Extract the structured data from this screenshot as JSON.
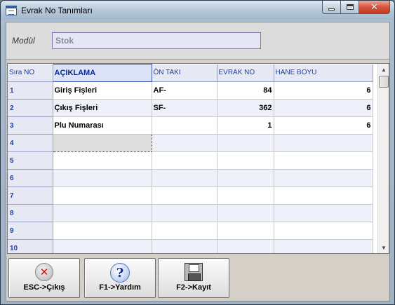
{
  "window": {
    "title": "Evrak No Tanımları"
  },
  "module": {
    "label": "Modül",
    "value": "Stok"
  },
  "grid": {
    "columns": [
      "Sıra NO",
      "AÇIKLAMA",
      "ÖN TAKI",
      "EVRAK NO",
      "HANE BOYU"
    ],
    "rows": [
      {
        "no": "1",
        "desc": "Giriş Fişleri",
        "prefix": "AF-",
        "number": "84",
        "digits": "6"
      },
      {
        "no": "2",
        "desc": "Çıkış Fişleri",
        "prefix": "SF-",
        "number": "362",
        "digits": "6"
      },
      {
        "no": "3",
        "desc": "Plu Numarası",
        "prefix": "",
        "number": "1",
        "digits": "6"
      },
      {
        "no": "4",
        "desc": "",
        "prefix": "",
        "number": "",
        "digits": ""
      },
      {
        "no": "5",
        "desc": "",
        "prefix": "",
        "number": "",
        "digits": ""
      },
      {
        "no": "6",
        "desc": "",
        "prefix": "",
        "number": "",
        "digits": ""
      },
      {
        "no": "7",
        "desc": "",
        "prefix": "",
        "number": "",
        "digits": ""
      },
      {
        "no": "8",
        "desc": "",
        "prefix": "",
        "number": "",
        "digits": ""
      },
      {
        "no": "9",
        "desc": "",
        "prefix": "",
        "number": "",
        "digits": ""
      },
      {
        "no": "10",
        "desc": "",
        "prefix": "",
        "number": "",
        "digits": ""
      }
    ]
  },
  "toolbar": {
    "esc_label": "ESC->Çıkış",
    "help_label": "F1->Yardım",
    "save_label": "F2->Kayıt"
  },
  "icons": {
    "exit": "close-circle-icon",
    "help": "question-mark-icon",
    "save": "floppy-disk-icon"
  }
}
